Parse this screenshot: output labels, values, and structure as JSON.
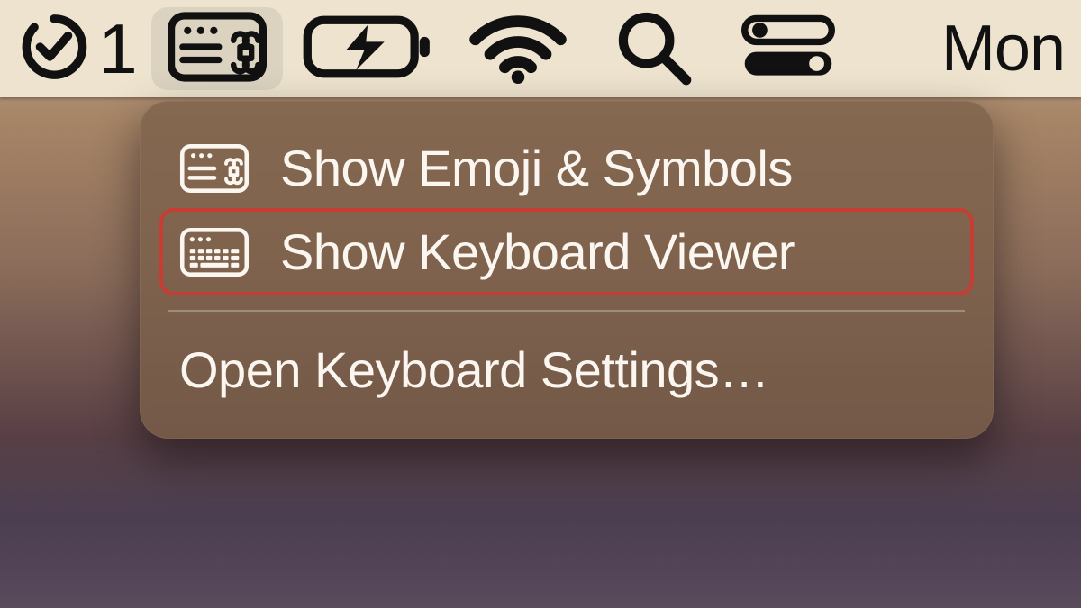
{
  "menubar": {
    "todo_count": "1",
    "day_label": "Mon"
  },
  "dropdown": {
    "items": [
      {
        "label": "Show Emoji & Symbols"
      },
      {
        "label": "Show Keyboard Viewer"
      }
    ],
    "settings_label": "Open Keyboard Settings…"
  },
  "icons": {
    "todo": "todo-check-icon",
    "input_menu": "input-menu-icon",
    "battery": "battery-charging-icon",
    "wifi": "wifi-icon",
    "search": "search-icon",
    "control_center": "control-center-icon",
    "emoji_panel": "character-viewer-icon",
    "keyboard_panel": "keyboard-viewer-icon"
  }
}
